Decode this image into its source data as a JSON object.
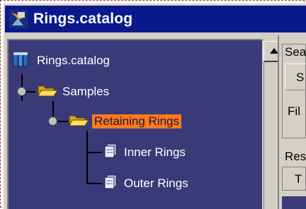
{
  "window": {
    "title": "Rings.catalog"
  },
  "tree": {
    "items": [
      {
        "label": "Rings.catalog",
        "icon": "catalog-icon"
      },
      {
        "label": "Samples",
        "icon": "open-folder-icon"
      },
      {
        "label": "Retaining Rings",
        "icon": "open-folder-icon",
        "selected": true
      },
      {
        "label": "Inner Rings",
        "icon": "document-icon"
      },
      {
        "label": "Outer Rings",
        "icon": "document-icon"
      }
    ]
  },
  "right_panel": {
    "search_label": "Sea",
    "s_text": "S",
    "fil_text": "Fil",
    "res_label": "Res",
    "t_text": "T"
  },
  "colors": {
    "titlebar": "#0a1a8c",
    "tree_background": "#3b3a78",
    "selection": "#ff7a1a",
    "dialog": "#d4d0c8"
  }
}
